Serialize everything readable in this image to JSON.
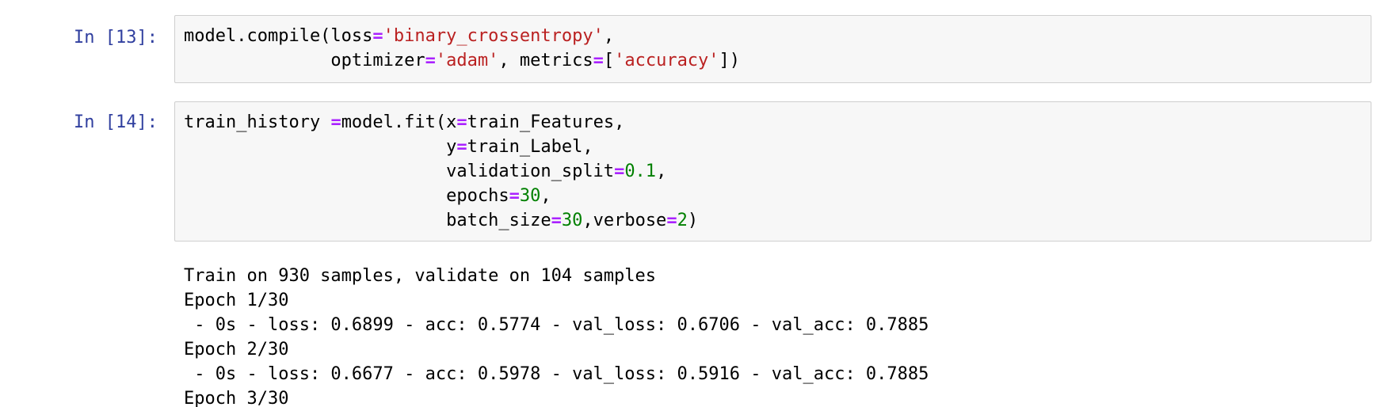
{
  "cells": [
    {
      "prompt": "In [13]:",
      "code_lines": [
        [
          {
            "t": "model.compile(loss",
            "k": "plain"
          },
          {
            "t": "=",
            "k": "op"
          },
          {
            "t": "'binary_crossentropy'",
            "k": "str"
          },
          {
            "t": ",",
            "k": "plain"
          }
        ],
        [
          {
            "t": "              optimizer",
            "k": "plain"
          },
          {
            "t": "=",
            "k": "op"
          },
          {
            "t": "'adam'",
            "k": "str"
          },
          {
            "t": ", metrics",
            "k": "plain"
          },
          {
            "t": "=",
            "k": "op"
          },
          {
            "t": "[",
            "k": "plain"
          },
          {
            "t": "'accuracy'",
            "k": "str"
          },
          {
            "t": "])",
            "k": "plain"
          }
        ]
      ]
    },
    {
      "prompt": "In [14]:",
      "code_lines": [
        [
          {
            "t": "train_history ",
            "k": "plain"
          },
          {
            "t": "=",
            "k": "op"
          },
          {
            "t": "model.fit(x",
            "k": "plain"
          },
          {
            "t": "=",
            "k": "op"
          },
          {
            "t": "train_Features,",
            "k": "plain"
          }
        ],
        [
          {
            "t": "                         y",
            "k": "plain"
          },
          {
            "t": "=",
            "k": "op"
          },
          {
            "t": "train_Label,",
            "k": "plain"
          }
        ],
        [
          {
            "t": "                         validation_split",
            "k": "plain"
          },
          {
            "t": "=",
            "k": "op"
          },
          {
            "t": "0.1",
            "k": "num"
          },
          {
            "t": ",",
            "k": "plain"
          }
        ],
        [
          {
            "t": "                         epochs",
            "k": "plain"
          },
          {
            "t": "=",
            "k": "op"
          },
          {
            "t": "30",
            "k": "num"
          },
          {
            "t": ",",
            "k": "plain"
          }
        ],
        [
          {
            "t": "                         batch_size",
            "k": "plain"
          },
          {
            "t": "=",
            "k": "op"
          },
          {
            "t": "30",
            "k": "num"
          },
          {
            "t": ",verbose",
            "k": "plain"
          },
          {
            "t": "=",
            "k": "op"
          },
          {
            "t": "2",
            "k": "num"
          },
          {
            "t": ")",
            "k": "plain"
          }
        ]
      ],
      "output_lines": [
        "Train on 930 samples, validate on 104 samples",
        "Epoch 1/30",
        " - 0s - loss: 0.6899 - acc: 0.5774 - val_loss: 0.6706 - val_acc: 0.7885",
        "Epoch 2/30",
        " - 0s - loss: 0.6677 - acc: 0.5978 - val_loss: 0.5916 - val_acc: 0.7885",
        "Epoch 3/30"
      ]
    }
  ],
  "colors": {
    "prompt": "#303f9f",
    "operator": "#aa22ff",
    "string": "#ba2121",
    "number": "#008000",
    "cell_background": "#f7f7f7",
    "cell_border": "#cfcfcf"
  }
}
